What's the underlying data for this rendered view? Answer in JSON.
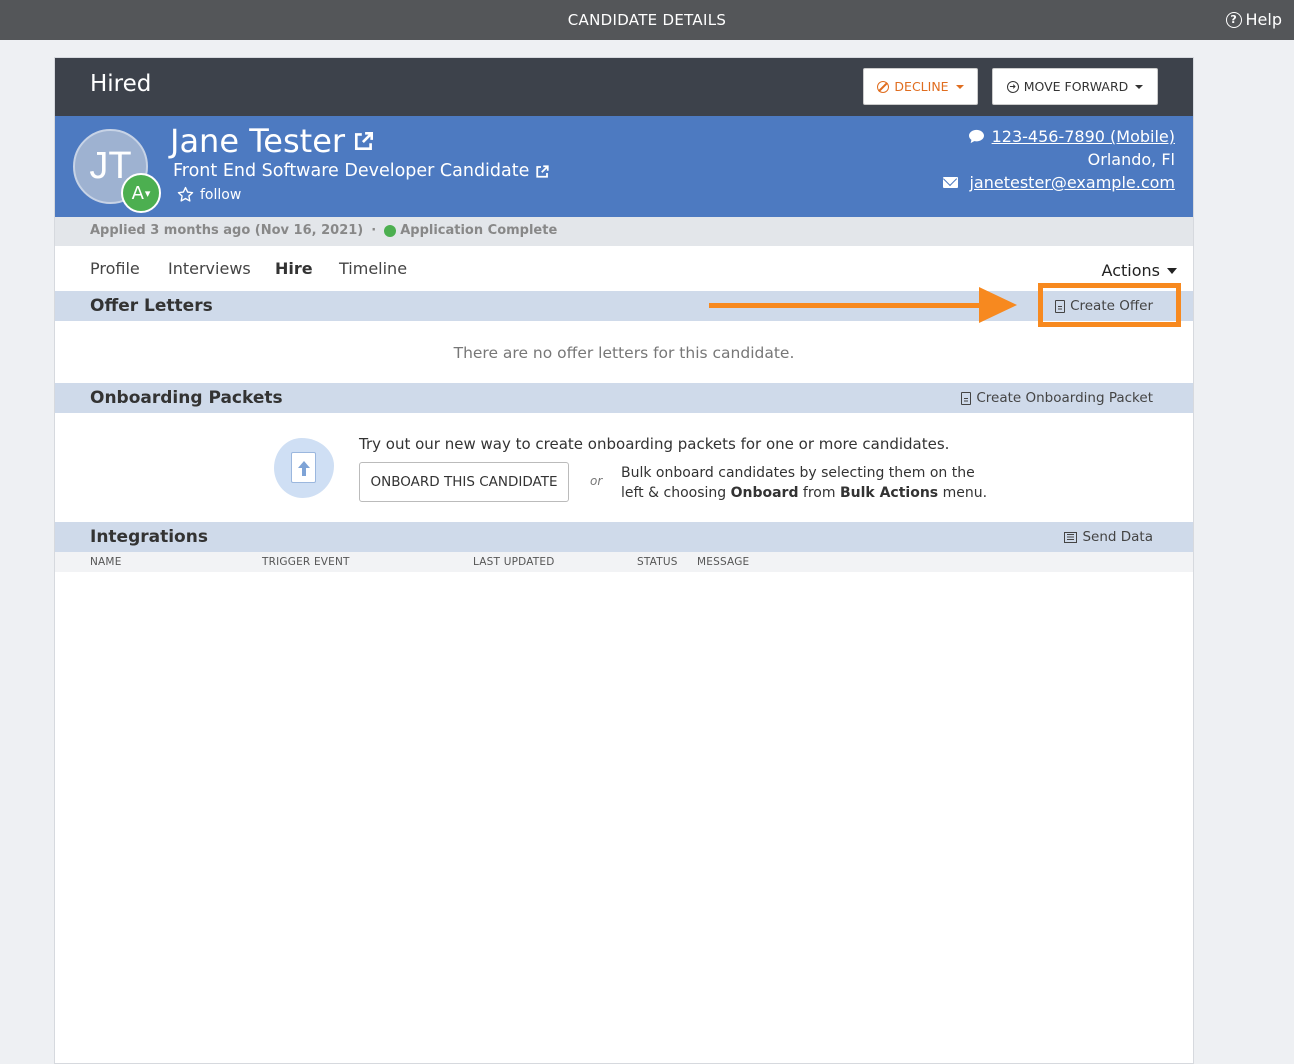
{
  "topbar": {
    "title": "CANDIDATE DETAILS",
    "help_label": "Help",
    "help_icon": "question-circle-icon"
  },
  "stage": {
    "label": "Hired",
    "decline_label": "DECLINE",
    "move_forward_label": "MOVE FORWARD",
    "decline_color": "#e06d1f"
  },
  "candidate": {
    "initials": "JT",
    "grade": "A",
    "name": "Jane Tester",
    "job": "Front End Software Developer Candidate",
    "follow_label": "follow",
    "phone": "123-456-7890 (Mobile)",
    "location": "Orlando, Fl",
    "email": "janetester@example.com"
  },
  "applied": {
    "text": "Applied 3 months ago (Nov 16, 2021)",
    "separator": "·",
    "status": "Application Complete",
    "status_color": "#4caf50"
  },
  "tabs": [
    {
      "label": "Profile"
    },
    {
      "label": "Interviews"
    },
    {
      "label": "Hire"
    },
    {
      "label": "Timeline"
    }
  ],
  "actions_label": "Actions",
  "offer_letters": {
    "title": "Offer Letters",
    "action_label": "Create Offer",
    "empty_message": "There are no offer letters for this candidate.",
    "highlight_color": "#f7891f"
  },
  "onboarding": {
    "title": "Onboarding Packets",
    "action_label": "Create Onboarding Packet",
    "try_text": "Try out our new way to create onboarding packets for one or more candidates.",
    "button_label": "ONBOARD THIS CANDIDATE",
    "or_text": "or",
    "bulk_part1": "Bulk onboard candidates by selecting them on the left & choosing ",
    "bulk_bold1": "Onboard",
    "bulk_part2": " from ",
    "bulk_bold2": "Bulk Actions",
    "bulk_part3": " menu."
  },
  "integrations": {
    "title": "Integrations",
    "action_label": "Send Data",
    "columns": [
      "NAME",
      "TRIGGER EVENT",
      "LAST UPDATED",
      "STATUS",
      "MESSAGE"
    ]
  },
  "colors": {
    "header_dark": "#3d424b",
    "hero_blue": "#4d7ac1",
    "section_blue": "#cfdaea"
  }
}
